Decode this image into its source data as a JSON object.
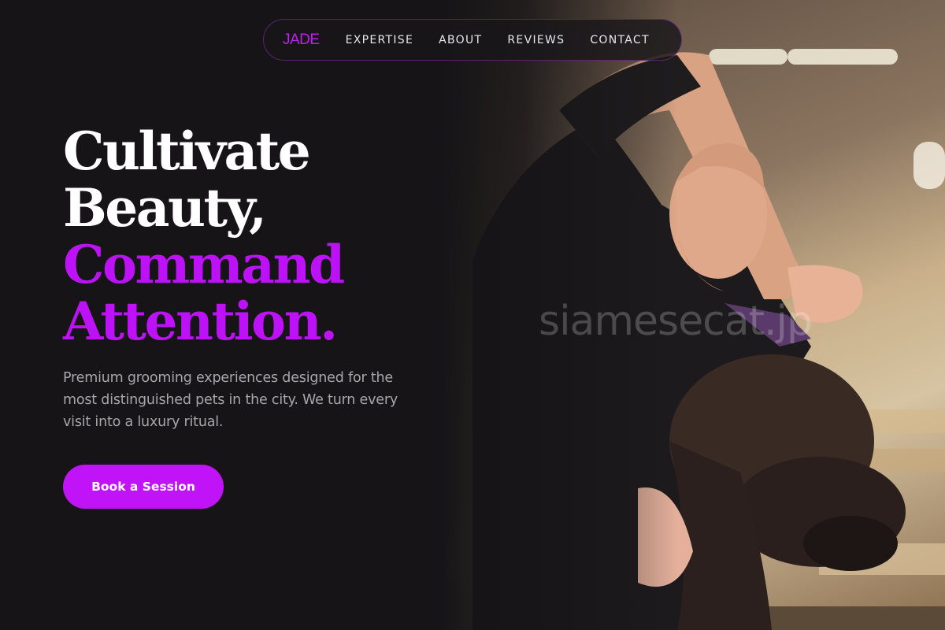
{
  "nav": {
    "logo": "JADE",
    "links": [
      {
        "label": "EXPERTISE"
      },
      {
        "label": "ABOUT"
      },
      {
        "label": "REVIEWS"
      },
      {
        "label": "CONTACT"
      }
    ]
  },
  "hero": {
    "headline": {
      "line1": "Cultivate",
      "line2": "Beauty,",
      "line3": "Command",
      "line4": "Attention."
    },
    "lede": "Premium grooming experiences designed for the most distinguished pets in the city. We turn every visit into a luxury ritual.",
    "cta_label": "Book a Session",
    "watermark": "siamesecat.jp"
  },
  "colors": {
    "background": "#161416",
    "accent": "#c113f7",
    "text": "#ffffff",
    "muted_text": "#a9a5ad"
  }
}
